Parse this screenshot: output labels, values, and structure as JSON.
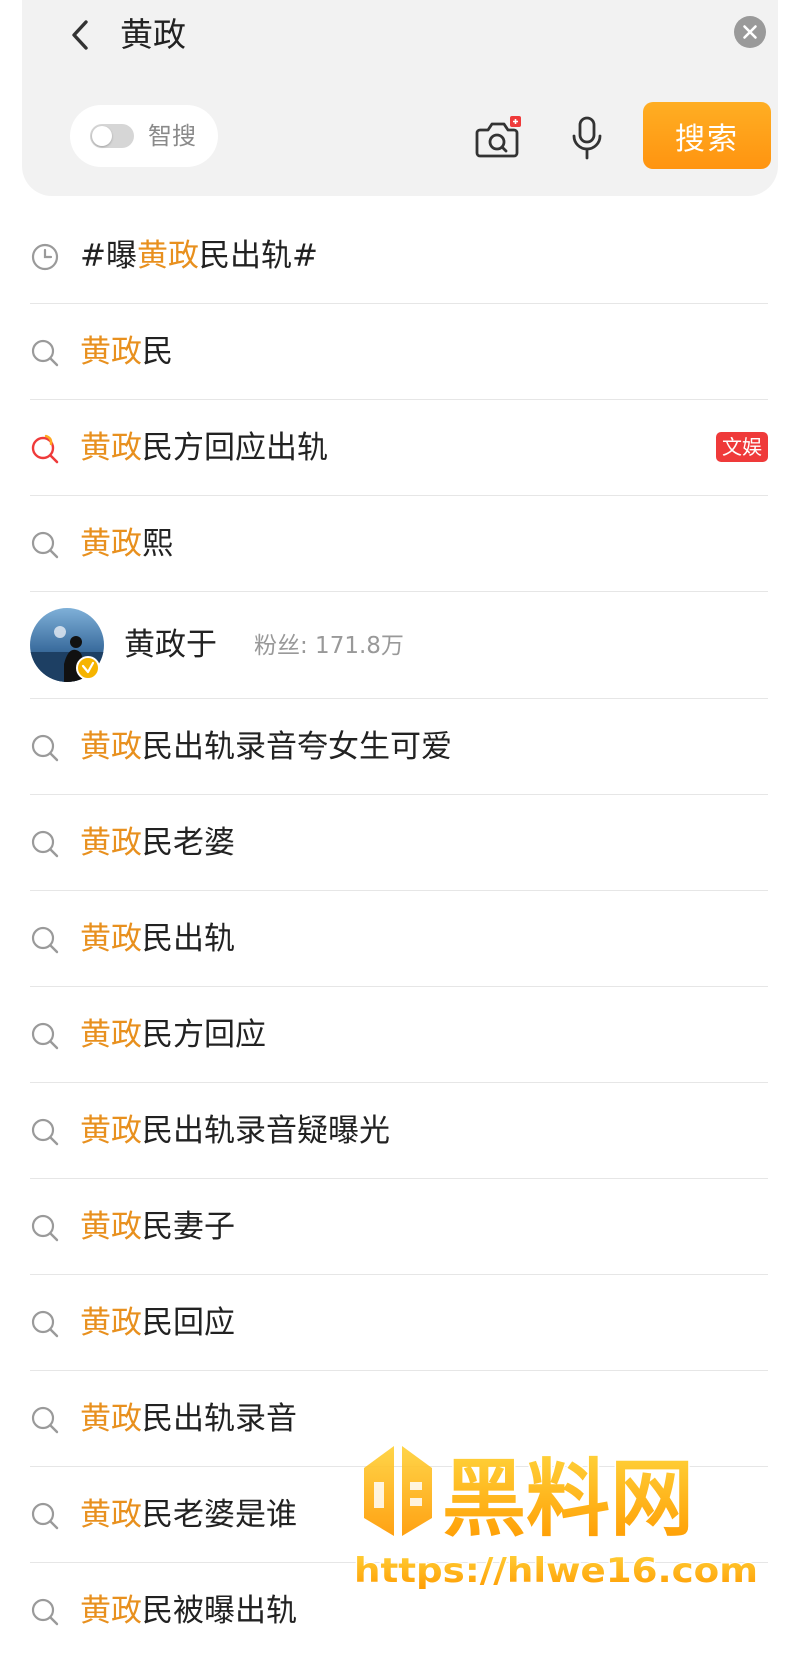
{
  "search": {
    "query": "黄政",
    "smart_search_label": "智搜",
    "smart_search_on": false,
    "search_button_label": "搜索"
  },
  "colors": {
    "highlight": "#e8901e",
    "accent_button": "#ff9f1a",
    "tag_red": "#ef3a3a"
  },
  "suggestions": [
    {
      "icon": "history-icon",
      "prefix": "#曝",
      "highlight": "黄政",
      "suffix": "民出轨#"
    },
    {
      "icon": "search-icon",
      "prefix": "",
      "highlight": "黄政",
      "suffix": "民"
    },
    {
      "icon": "hot-search-icon",
      "prefix": "",
      "highlight": "黄政",
      "suffix": "民方回应出轨",
      "tag": "文娱"
    },
    {
      "icon": "search-icon",
      "prefix": "",
      "highlight": "黄政",
      "suffix": "熙"
    },
    {
      "icon": "search-icon",
      "prefix": "",
      "highlight": "黄政",
      "suffix": "民出轨录音夸女生可爱"
    },
    {
      "icon": "search-icon",
      "prefix": "",
      "highlight": "黄政",
      "suffix": "民老婆"
    },
    {
      "icon": "search-icon",
      "prefix": "",
      "highlight": "黄政",
      "suffix": "民出轨"
    },
    {
      "icon": "search-icon",
      "prefix": "",
      "highlight": "黄政",
      "suffix": "民方回应"
    },
    {
      "icon": "search-icon",
      "prefix": "",
      "highlight": "黄政",
      "suffix": "民出轨录音疑曝光"
    },
    {
      "icon": "search-icon",
      "prefix": "",
      "highlight": "黄政",
      "suffix": "民妻子"
    },
    {
      "icon": "search-icon",
      "prefix": "",
      "highlight": "黄政",
      "suffix": "民回应"
    },
    {
      "icon": "search-icon",
      "prefix": "",
      "highlight": "黄政",
      "suffix": "民出轨录音"
    },
    {
      "icon": "search-icon",
      "prefix": "",
      "highlight": "黄政",
      "suffix": "民老婆是谁"
    },
    {
      "icon": "search-icon",
      "prefix": "",
      "highlight": "黄政",
      "suffix": "民被曝出轨"
    }
  ],
  "user_result": {
    "name": "黄政于",
    "fans": "粉丝: 171.8万",
    "verified": true
  },
  "watermark": {
    "brand": "黑料网",
    "url": "https://hlwe16.com"
  }
}
